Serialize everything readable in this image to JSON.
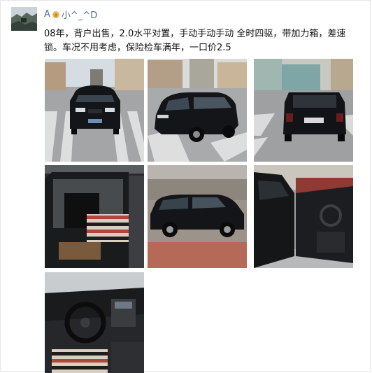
{
  "post": {
    "username_prefix": "A",
    "username_icon": "gold-emblem-icon",
    "username_suffix": "小^_^D",
    "text": "08年，背户出售，2.0水平对置，手动手动手动 全时四驱，带加力箱，差速锁。车况不用考虑，保险检车满年，一口价2.5",
    "photos": [
      {
        "subject": "black SUV front view on crosswalk"
      },
      {
        "subject": "black SUV front three-quarter view"
      },
      {
        "subject": "black SUV rear view"
      },
      {
        "subject": "rear seats with striped seat cushions"
      },
      {
        "subject": "black SUV side view in lot"
      },
      {
        "subject": "open driver door interior"
      },
      {
        "subject": "dashboard and steering wheel"
      }
    ]
  },
  "colors": {
    "username": "#576b95",
    "text": "#111111",
    "car_body": "#141518",
    "pavement": "#9a9c9e",
    "sky": "#d9e2e8"
  }
}
